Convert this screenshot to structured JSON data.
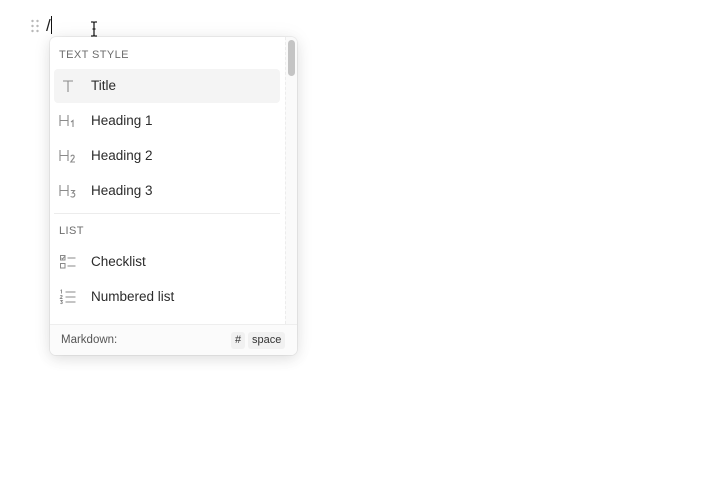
{
  "editor": {
    "typed_text": "/"
  },
  "menu": {
    "sections": [
      {
        "label": "TEXT STYLE",
        "items": [
          {
            "label": "Title",
            "icon": "title-icon",
            "active": true
          },
          {
            "label": "Heading 1",
            "icon": "heading-1-icon"
          },
          {
            "label": "Heading 2",
            "icon": "heading-2-icon"
          },
          {
            "label": "Heading 3",
            "icon": "heading-3-icon"
          }
        ]
      },
      {
        "label": "LIST",
        "items": [
          {
            "label": "Checklist",
            "icon": "checklist-icon"
          },
          {
            "label": "Numbered list",
            "icon": "numbered-list-icon"
          }
        ]
      }
    ],
    "footer": {
      "label": "Markdown:",
      "keys": [
        "#",
        "space"
      ]
    }
  },
  "colors": {
    "active_item_bg": "#f4f4f4",
    "icon_gray": "#8a8a8a",
    "text": "#2b2b2b",
    "section_label": "#6d6d6d"
  }
}
